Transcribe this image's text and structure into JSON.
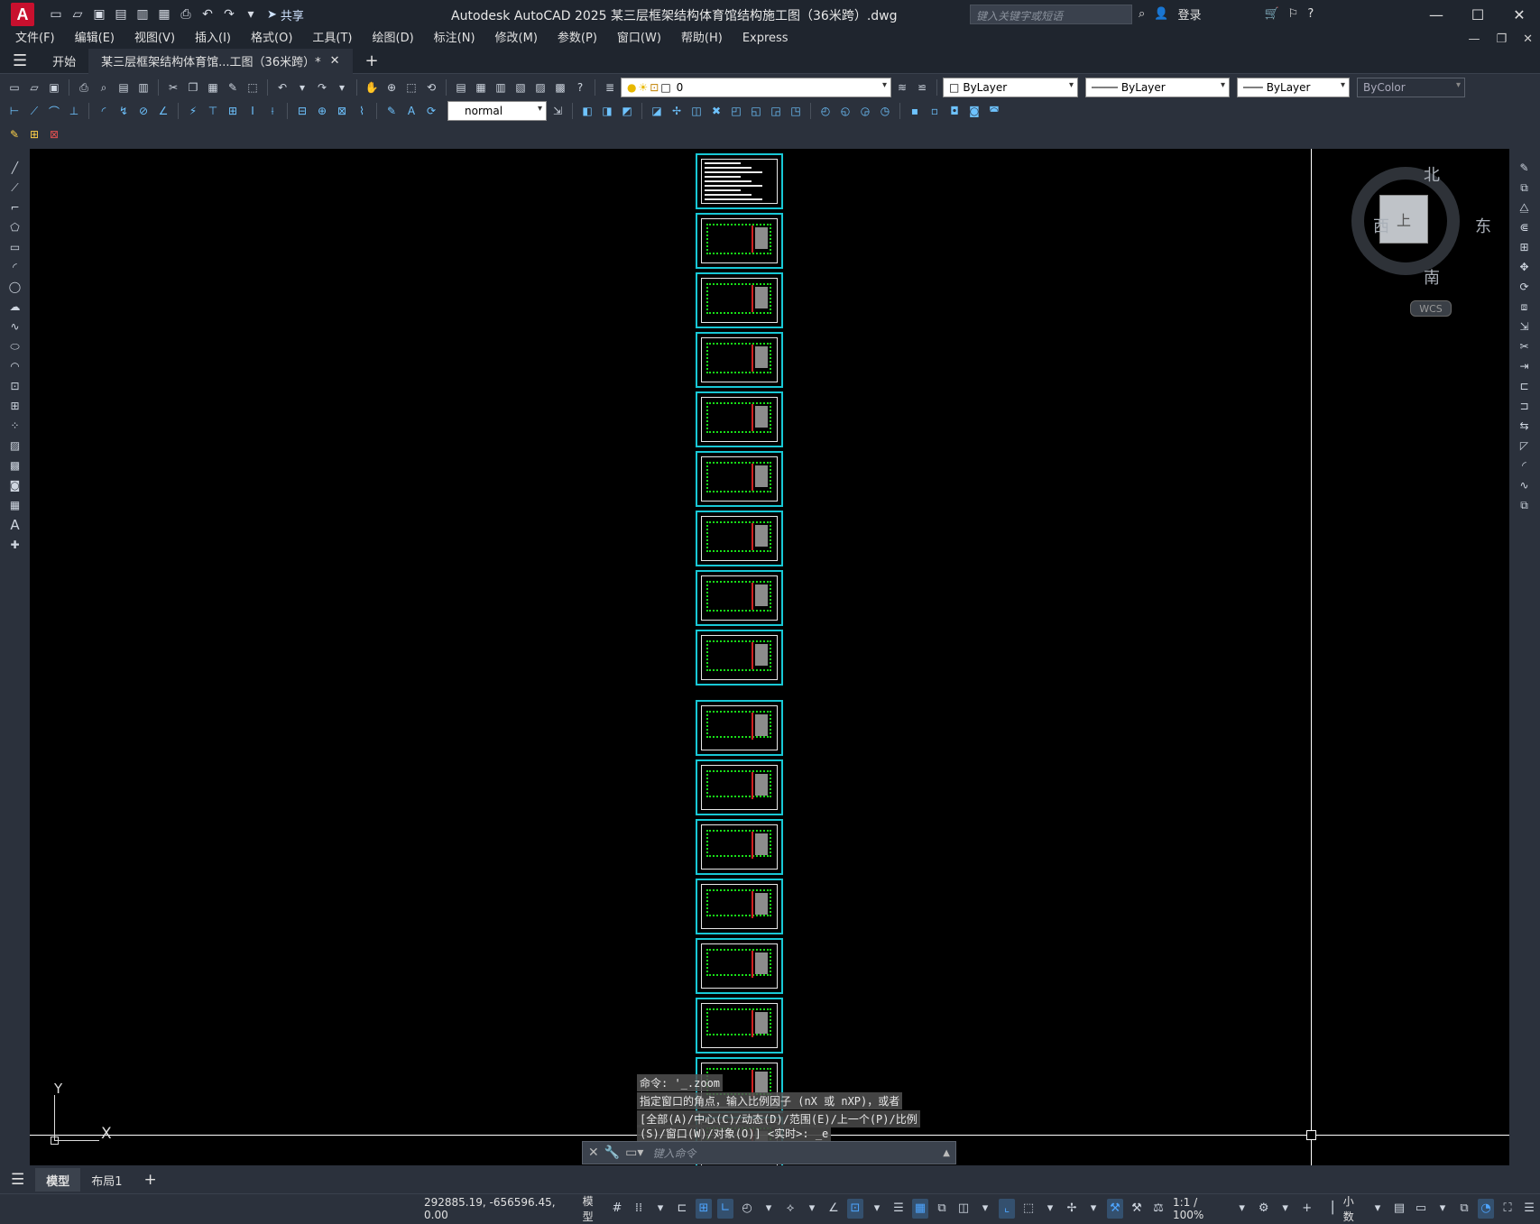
{
  "titlebar": {
    "app_logo": "A",
    "share_label": "共享",
    "title": "Autodesk AutoCAD 2025    某三层框架结构体育馆结构施工图（36米跨）.dwg",
    "search_placeholder": "键入关键字或短语",
    "signin_label": "登录"
  },
  "menu": {
    "items": [
      "文件(F)",
      "编辑(E)",
      "视图(V)",
      "插入(I)",
      "格式(O)",
      "工具(T)",
      "绘图(D)",
      "标注(N)",
      "修改(M)",
      "参数(P)",
      "窗口(W)",
      "帮助(H)",
      "Express"
    ]
  },
  "tabs": {
    "start_label": "开始",
    "doc_label": "某三层框架结构体育馆...工图（36米跨）*"
  },
  "toolbar": {
    "layer_value": "0",
    "color_value": "ByLayer",
    "linetype_value": "ByLayer",
    "lineweight_value": "ByLayer",
    "plotstyle_value": "ByColor",
    "dimstyle_value": "normal"
  },
  "viewcube": {
    "north": "北",
    "south": "南",
    "east": "东",
    "west": "西",
    "face": "上",
    "wcs_label": "WCS"
  },
  "ucs": {
    "x_label": "X",
    "y_label": "Y"
  },
  "command": {
    "history": [
      "命令: '_.zoom",
      "指定窗口的角点，输入比例因子 (nX 或 nXP)，或者",
      "[全部(A)/中心(C)/动态(D)/范围(E)/上一个(P)/比例",
      "(S)/窗口(W)/对象(O)] <实时>: _e"
    ],
    "placeholder": "键入命令"
  },
  "layout_tabs": {
    "model_label": "模型",
    "layout1_label": "布局1"
  },
  "status": {
    "coordinates": "292885.19, -656596.45, 0.00",
    "model_label": "模型",
    "scale_label": "1:1 / 100%",
    "units_label": "小数"
  },
  "drawing": {
    "sheet_count": 17,
    "frame_color": "#18c8d6",
    "grid_color": "#18e018",
    "column_color": "#d02020"
  }
}
